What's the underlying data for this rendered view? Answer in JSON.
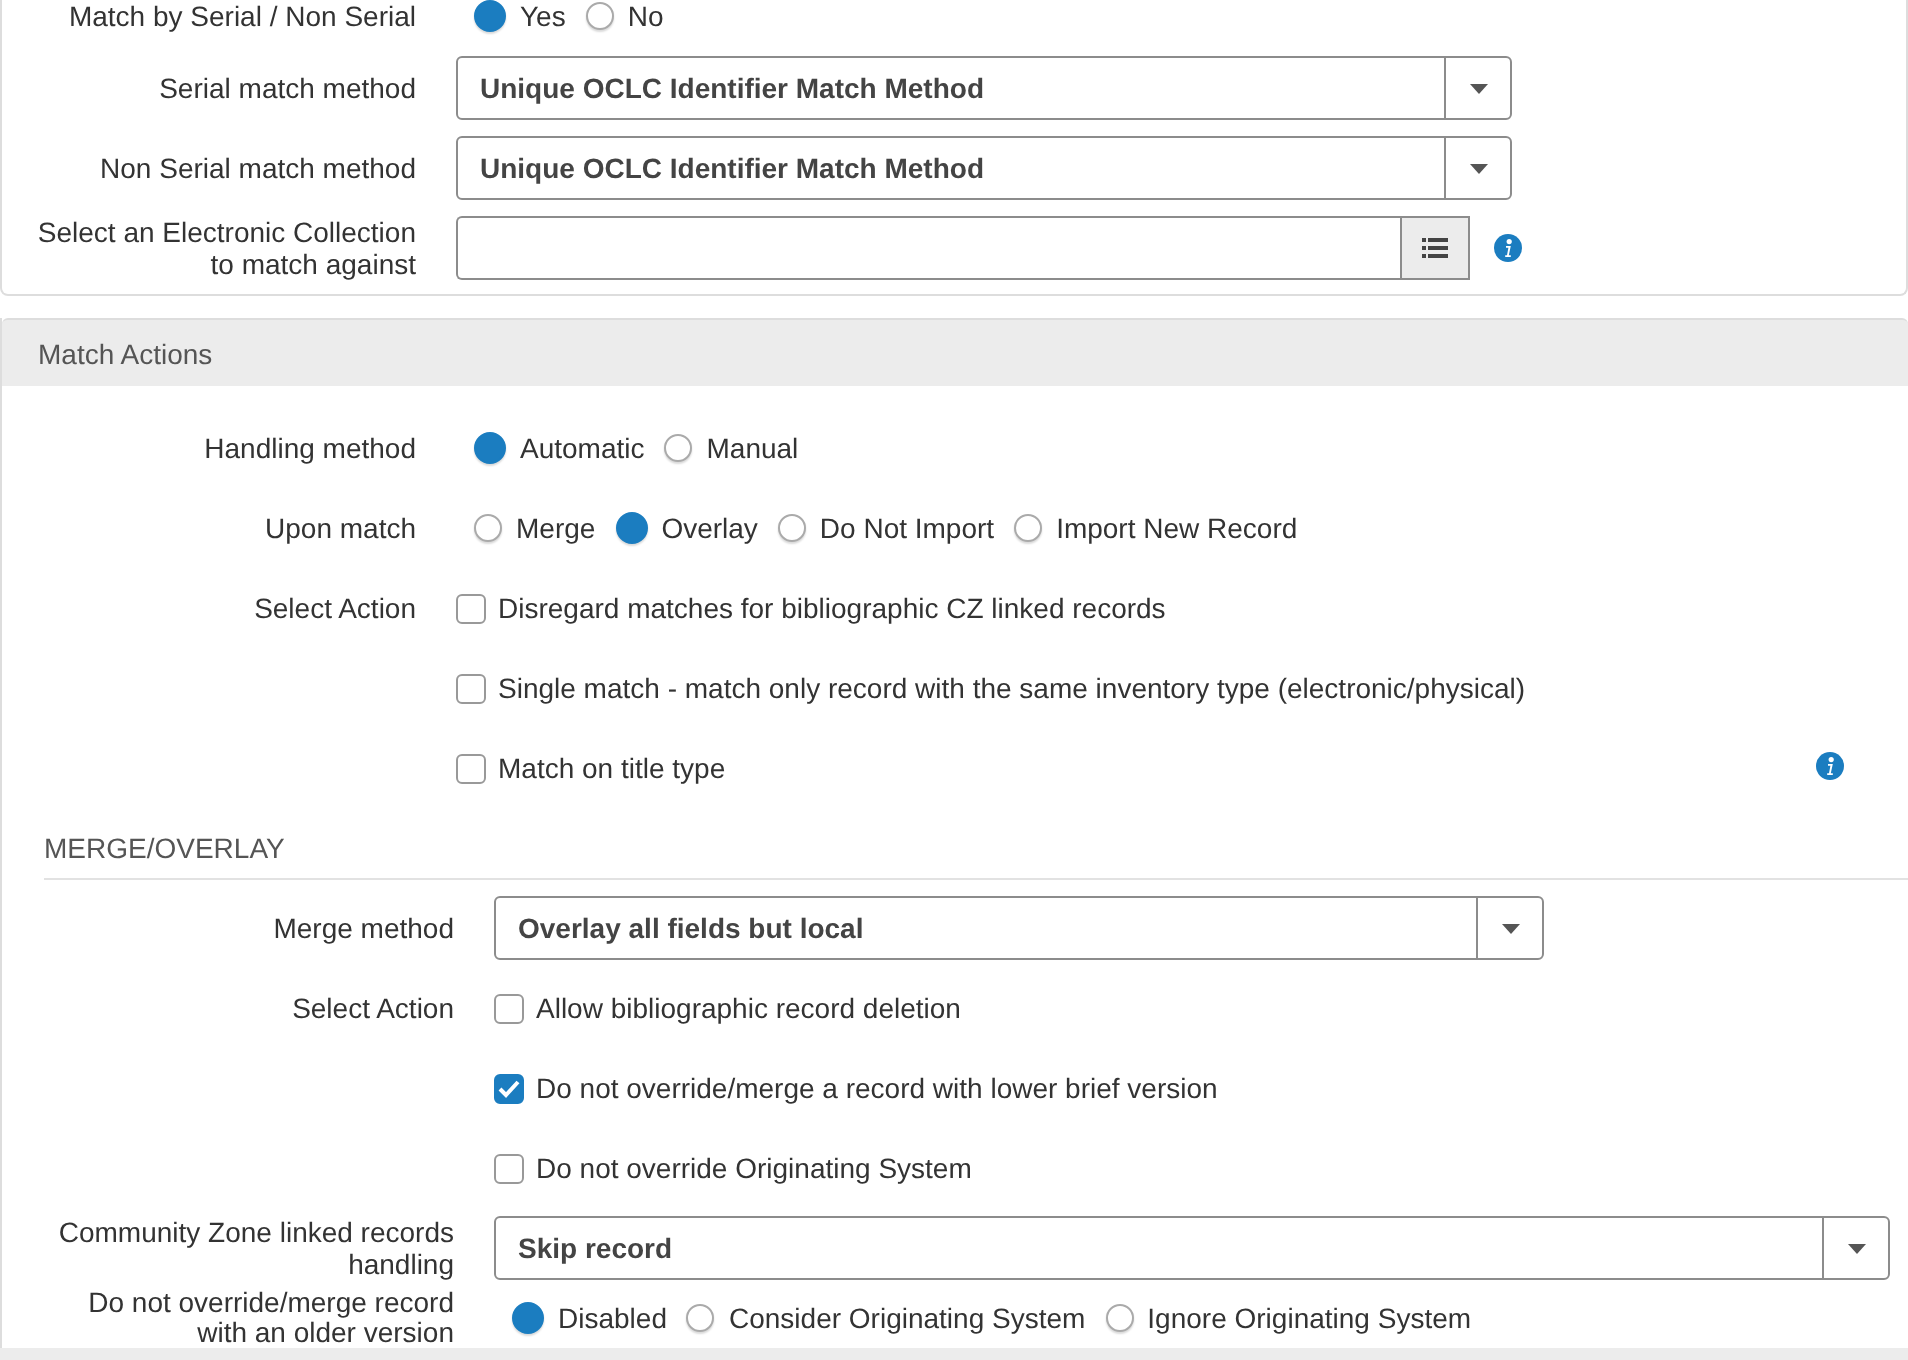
{
  "top_section": {
    "rows": [
      {
        "kind": "radio",
        "label": "Match by Serial / Non Serial",
        "options": [
          {
            "label": "Yes",
            "selected": true
          },
          {
            "label": "No",
            "selected": false
          }
        ]
      },
      {
        "kind": "select",
        "label": "Serial match method",
        "value": "Unique OCLC Identifier Match Method"
      },
      {
        "kind": "select",
        "label": "Non Serial match method",
        "value": "Unique OCLC Identifier Match Method"
      },
      {
        "kind": "picker",
        "label": "Select an Electronic Collection\nto match against",
        "info": true
      }
    ]
  },
  "match_actions": {
    "title": "Match Actions",
    "rows": [
      {
        "kind": "radio",
        "label": "Handling method",
        "options": [
          {
            "label": "Automatic",
            "selected": true
          },
          {
            "label": "Manual",
            "selected": false
          }
        ]
      },
      {
        "kind": "radio",
        "label": "Upon match",
        "options": [
          {
            "label": "Merge",
            "selected": false
          },
          {
            "label": "Overlay",
            "selected": true
          },
          {
            "label": "Do Not Import",
            "selected": false
          },
          {
            "label": "Import New Record",
            "selected": false
          }
        ]
      },
      {
        "kind": "checks",
        "label": "Select Action",
        "items": [
          {
            "label": "Disregard matches for bibliographic CZ linked records",
            "checked": false
          },
          {
            "label": "Single match - match only record with the same inventory type (electronic/physical)",
            "checked": false
          },
          {
            "label": "Match on title type",
            "checked": false,
            "info": true
          }
        ]
      }
    ]
  },
  "merge_overlay": {
    "title": "MERGE/OVERLAY",
    "rows": [
      {
        "kind": "select",
        "label": "Merge method",
        "value": "Overlay all fields but local"
      },
      {
        "kind": "checks",
        "label": "Select Action",
        "items": [
          {
            "label": "Allow bibliographic record deletion",
            "checked": false
          },
          {
            "label": "Do not override/merge a record with lower brief version",
            "checked": true
          },
          {
            "label": "Do not override Originating System",
            "checked": false
          }
        ]
      },
      {
        "kind": "select",
        "label": "Community Zone linked records\nhandling",
        "value": "Skip record",
        "wide": true
      },
      {
        "kind": "radio",
        "label": "Do not override/merge record\nwith an older version",
        "short": true,
        "options": [
          {
            "label": "Disabled",
            "selected": true
          },
          {
            "label": "Consider Originating System",
            "selected": false
          },
          {
            "label": "Ignore Originating System",
            "selected": false
          }
        ]
      }
    ]
  }
}
